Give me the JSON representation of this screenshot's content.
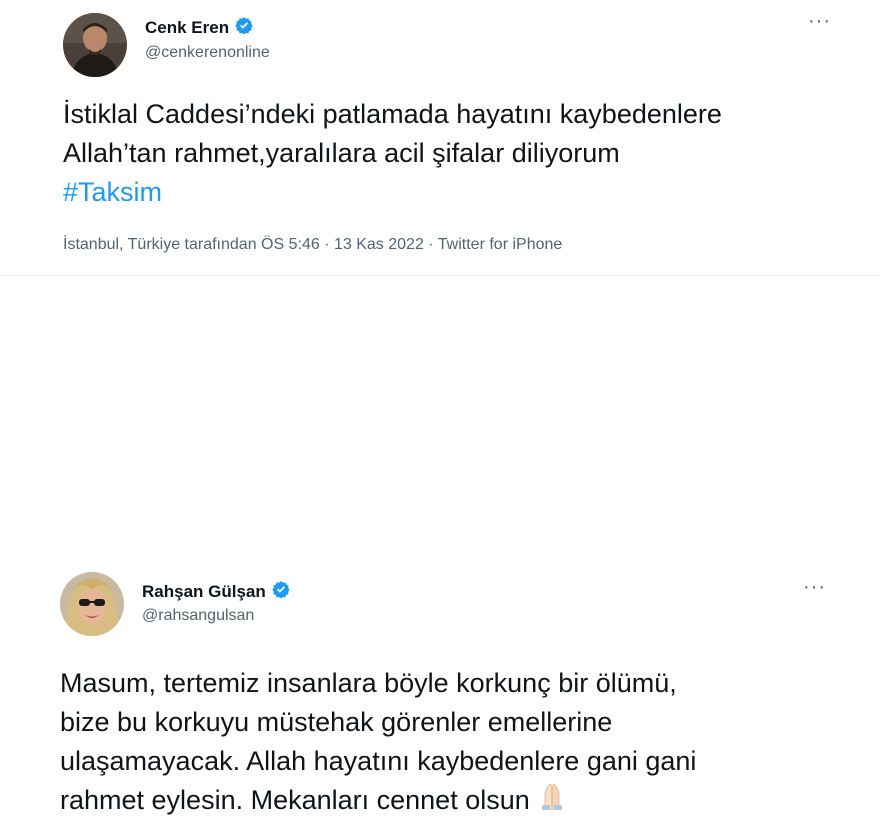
{
  "tweets": [
    {
      "name": "Cenk Eren",
      "handle": "@cenkerenonline",
      "text_lines": [
        "İstiklal Caddesi’ndeki patlamada hayatını kaybedenlere",
        "Allah’tan rahmet,yaralılara acil şifalar diliyorum"
      ],
      "hashtag": "#Taksim",
      "location_time": "İstanbul, Türkiye tarafından ÖS 5:46",
      "date": "13 Kas 2022",
      "source": "Twitter for iPhone",
      "sep": "·",
      "more": "···"
    },
    {
      "name": "Rahşan Gülşan",
      "handle": "@rahsangulsan",
      "text_lines": [
        "Masum, tertemiz insanlara böyle korkunç bir ölümü,",
        "bize bu korkuyu müstehak görenler emellerine",
        "ulaşamayacak. Allah hayatını kaybedenlere gani gani",
        "rahmet eylesin. Mekanları cennet olsun"
      ],
      "more": "···"
    }
  ],
  "colors": {
    "link": "#1d9bf0",
    "verified": "#1d9bf0",
    "secondary": "#536471",
    "text": "#0f1419"
  },
  "icons": {
    "verified": "verified-badge-icon",
    "more": "more-icon",
    "emoji": "folded-hands-icon"
  }
}
